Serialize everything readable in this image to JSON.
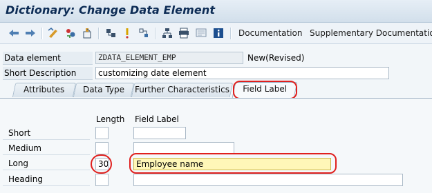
{
  "window": {
    "title": "Dictionary: Change Data Element"
  },
  "toolbar": {
    "icons": [
      "back-arrow-icon",
      "forward-arrow-icon",
      "toggle-edit-icon",
      "other-object-icon",
      "activate-icon",
      "check-icon",
      "where-used-icon",
      "display-object-list-icon",
      "hierarchy-icon",
      "print-icon",
      "screen-icon",
      "info-icon"
    ],
    "documentation_label": "Documentation",
    "supplementary_label": "Supplementary Documentation"
  },
  "header": {
    "data_element_label": "Data element",
    "data_element_value": "ZDATA_ELEMENT_EMP",
    "status": "New(Revised)",
    "short_desc_label": "Short Description",
    "short_desc_value": "customizing date element"
  },
  "tabs": [
    {
      "label": "Attributes",
      "active": false
    },
    {
      "label": "Data Type",
      "active": false
    },
    {
      "label": "Further Characteristics",
      "active": false
    },
    {
      "label": "Field Label",
      "active": true
    }
  ],
  "field_labels": {
    "length_header": "Length",
    "label_header": "Field Label",
    "rows": [
      {
        "name": "Short",
        "length": "",
        "label": ""
      },
      {
        "name": "Medium",
        "length": "",
        "label": ""
      },
      {
        "name": "Long",
        "length": "30",
        "label": "Employee name"
      },
      {
        "name": "Heading",
        "length": "",
        "label": ""
      }
    ]
  },
  "colors": {
    "highlight": "#e0201e",
    "focus_field": "#fff7b8",
    "title": "#0d2c55"
  }
}
